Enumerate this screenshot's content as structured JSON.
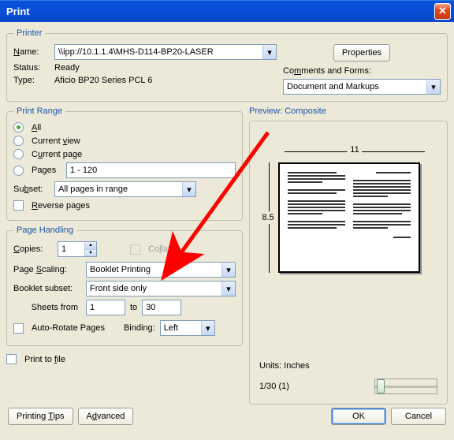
{
  "title": "Print",
  "printer": {
    "legend": "Printer",
    "name_label": "Name:",
    "name_value": "\\\\ipp://10.1.1.4\\MHS-D114-BP20-LASER",
    "status_label": "Status:",
    "status_value": "Ready",
    "type_label": "Type:",
    "type_value": "Aficio BP20 Series PCL 6",
    "properties_btn": "Properties",
    "comments_label": "Comments and Forms:",
    "comments_value": "Document and Markups"
  },
  "range": {
    "legend": "Print Range",
    "all": "All",
    "current_view": "Current view",
    "current_page": "Current page",
    "pages_label": "Pages",
    "pages_value": "1 - 120",
    "subset_label": "Subset:",
    "subset_value": "All pages in range",
    "reverse": "Reverse pages"
  },
  "handling": {
    "legend": "Page Handling",
    "copies_label": "Copies:",
    "copies_value": "1",
    "collate": "Collate",
    "scaling_label": "Page Scaling:",
    "scaling_value": "Booklet Printing",
    "booklet_label": "Booklet subset:",
    "booklet_value": "Front side only",
    "sheets_from_label": "Sheets from",
    "sheets_from_value": "1",
    "to_label": "to",
    "sheets_to_value": "30",
    "autorotate": "Auto-Rotate Pages",
    "binding_label": "Binding:",
    "binding_value": "Left"
  },
  "print_to_file": "Print to file",
  "preview": {
    "label": "Preview: Composite",
    "width": "11",
    "height": "8.5",
    "units_label": "Units:",
    "units_value": "Inches",
    "page_indicator": "1/30 (1)"
  },
  "buttons": {
    "printing_tips": "Printing Tips",
    "advanced": "Advanced",
    "ok": "OK",
    "cancel": "Cancel"
  }
}
